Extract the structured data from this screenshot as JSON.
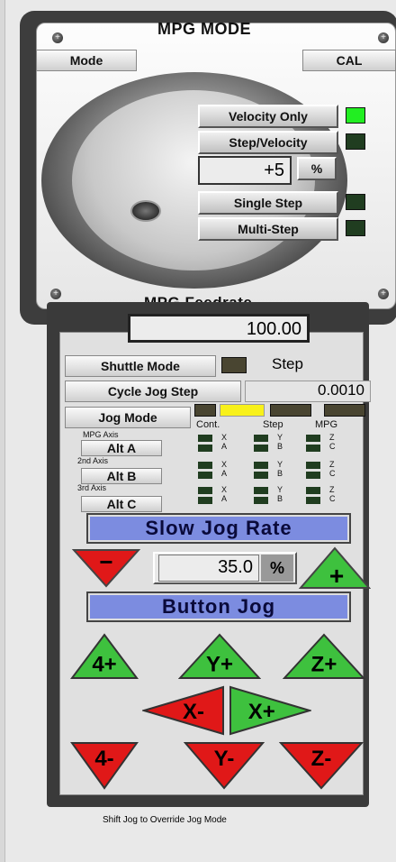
{
  "mpg": {
    "title": "MPG MODE",
    "mode_button": "Mode",
    "cal_button": "CAL",
    "velocity_only": "Velocity Only",
    "step_velocity": "Step/Velocity",
    "increment_value": "+5",
    "percent_button": "%",
    "single_step": "Single Step",
    "multi_step": "Multi-Step",
    "feedrate_label": "MPG Feedrate",
    "feedrate_value": "100.00"
  },
  "jog": {
    "shuttle_mode": "Shuttle Mode",
    "step_label": "Step",
    "cycle_jog_step": "Cycle Jog Step",
    "step_value": "0.0010",
    "jog_mode": "Jog Mode",
    "cont_label": "Cont.",
    "step_col": "Step",
    "mpg_col": "MPG",
    "mpg_axis_label": "MPG Axis",
    "alt_a": "Alt A",
    "second_axis_label": "2nd Axis",
    "alt_b": "Alt B",
    "third_axis_label": "3rd Axis",
    "alt_c": "Alt C",
    "axes": [
      [
        "X",
        "A"
      ],
      [
        "Y",
        "B"
      ],
      [
        "Z",
        "C"
      ]
    ],
    "slow_jog_rate": "Slow Jog Rate",
    "minus": "−",
    "jog_rate_value": "35.0",
    "percent": "%",
    "plus": "+",
    "button_jog": "Button Jog",
    "b4p": "4+",
    "byp": "Y+",
    "bzp": "Z+",
    "bxm": "X-",
    "bxp": "X+",
    "b4m": "4-",
    "bym": "Y-",
    "bzm": "Z-",
    "footer": "Shift Jog to Override Jog Mode"
  },
  "colors": {
    "led_on": "#22ee22",
    "led_off": "#203d20",
    "led_yellow": "#f8f11a",
    "up_green": "#3ec13e",
    "down_red": "#e01818",
    "banner": "#7c8ce0"
  }
}
